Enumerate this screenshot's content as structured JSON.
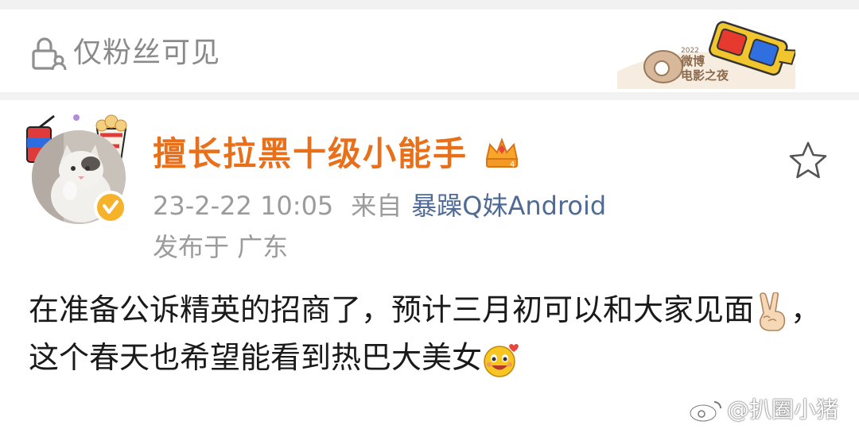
{
  "visibility": {
    "icon": "lock-person-icon",
    "label": "仅粉丝可见"
  },
  "sticker": {
    "icon": "3d-glasses-sticker",
    "year": "2022",
    "line1": "微博",
    "line2": "电影之夜"
  },
  "post": {
    "author": {
      "name": "擅长拉黑十级小能手",
      "avatar": "cat-avatar-with-popcorn-and-soda",
      "verified": true,
      "badge_icon": "crown-icon"
    },
    "timestamp": "23-2-22 10:05",
    "from_label": "来自",
    "source": "暴躁Q妹Android",
    "location": "发布于 广东",
    "text_part1": "在准备公诉精英的招商了，预计三月初可以和大家见面",
    "text_part2": "，这个春天也希望能看到热巴大美女",
    "emojis": [
      "victory-hand-emoji",
      "heart-eyes-emoji"
    ],
    "favorite_icon": "star-outline-icon"
  },
  "watermark": {
    "text": "@扒圈小猪",
    "icon": "weibo-logo-icon"
  },
  "colors": {
    "username": "#e8701b",
    "source_link": "#4f6b95",
    "meta": "#9b9b9b",
    "divider": "#f2f2f2"
  }
}
